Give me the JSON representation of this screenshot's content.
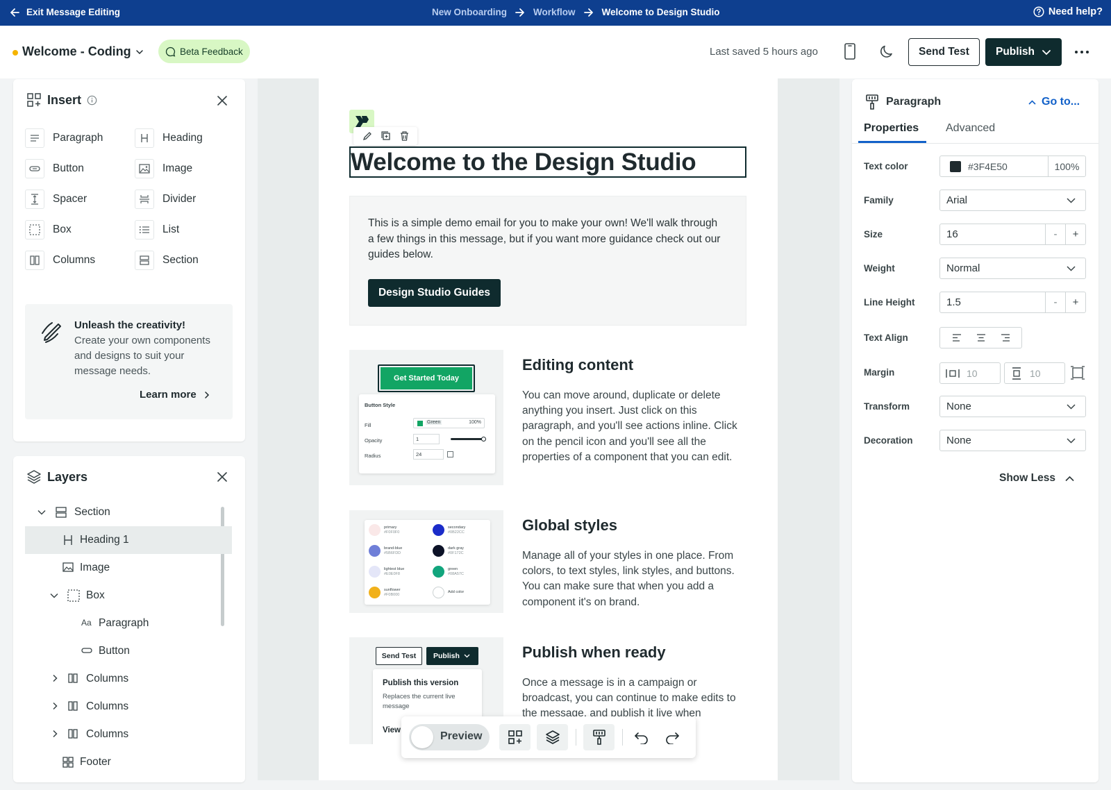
{
  "topbar": {
    "exit_label": "Exit Message Editing",
    "crumbs": [
      "New Onboarding",
      "Workflow",
      "Welcome to Design Studio"
    ],
    "help_label": "Need help?"
  },
  "header": {
    "message_name": "Welcome - Coding",
    "beta_label": "Beta Feedback",
    "saved_text": "Last saved 5 hours ago",
    "send_test_label": "Send Test",
    "publish_label": "Publish"
  },
  "insert_panel": {
    "title": "Insert",
    "items": [
      {
        "label": "Paragraph",
        "icon": "paragraph-icon"
      },
      {
        "label": "Heading",
        "icon": "heading-icon"
      },
      {
        "label": "Button",
        "icon": "button-icon"
      },
      {
        "label": "Image",
        "icon": "image-icon"
      },
      {
        "label": "Spacer",
        "icon": "spacer-icon"
      },
      {
        "label": "Divider",
        "icon": "divider-icon"
      },
      {
        "label": "Box",
        "icon": "box-icon"
      },
      {
        "label": "List",
        "icon": "list-icon"
      },
      {
        "label": "Columns",
        "icon": "columns-icon"
      },
      {
        "label": "Section",
        "icon": "section-icon"
      }
    ],
    "promo": {
      "title": "Unleash the creativity!",
      "body": "Create your own components and designs to suit your message needs.",
      "link": "Learn more"
    }
  },
  "layers_panel": {
    "title": "Layers",
    "items": [
      {
        "label": "Section",
        "icon": "section-icon"
      },
      {
        "label": "Heading 1",
        "icon": "heading-icon"
      },
      {
        "label": "Image",
        "icon": "image-icon"
      },
      {
        "label": "Box",
        "icon": "box-icon"
      },
      {
        "label": "Paragraph",
        "icon": "paragraph-text-icon"
      },
      {
        "label": "Button",
        "icon": "button-icon"
      },
      {
        "label": "Columns",
        "icon": "columns-icon"
      },
      {
        "label": "Columns",
        "icon": "columns-icon"
      },
      {
        "label": "Columns",
        "icon": "columns-icon"
      },
      {
        "label": "Footer",
        "icon": "footer-icon"
      }
    ]
  },
  "email": {
    "heading": "Welcome to the Design Studio",
    "intro": "This is a simple demo email for you to make your own! We'll walk through a few things in this message, but if you want more guidance check out our guides below.",
    "guides_button": "Design Studio Guides",
    "sections": [
      {
        "title": "Editing content",
        "body": "You can move around, duplicate or delete anything you insert. Just click on this paragraph, and you'll see actions inline. Click on the pencil icon and you'll see all the properties of a component that you can edit."
      },
      {
        "title": "Global styles",
        "body": "Manage all of your styles in one place. From colors, to text styles, link styles, and buttons. You can make sure that when you add a component it's on brand."
      },
      {
        "title": "Publish when ready",
        "body": "Once a message is in a campaign or broadcast, you can continue to make edits to the message, and publish it live when"
      }
    ],
    "thumb1": {
      "button": "Get Started Today",
      "card_title": "Button Style",
      "fill_label": "Fill",
      "fill_value": "Green",
      "fill_pct": "100%",
      "opacity_label": "Opacity",
      "opacity_value": "1",
      "radius_label": "Radius",
      "radius_value": "24"
    },
    "thumb2": {
      "swatches": [
        {
          "name": "primary",
          "hex": "#F0F0F0",
          "color": "#fae8e8"
        },
        {
          "name": "secondary",
          "hex": "#0B22CC",
          "color": "#1b2cc9"
        },
        {
          "name": "brand-blue",
          "hex": "#5B6FDD",
          "color": "#6f7fd8"
        },
        {
          "name": "dark gray",
          "hex": "#0F172C",
          "color": "#0c1227"
        },
        {
          "name": "lightest blue",
          "hex": "#E0E0F8",
          "color": "#e4e6f8"
        },
        {
          "name": "green",
          "hex": "#08A57C",
          "color": "#12a57d"
        },
        {
          "name": "sunflower",
          "hex": "#F0B000",
          "color": "#f1b11b"
        },
        {
          "name": "Add color",
          "hex": "",
          "color": "#ffffff"
        }
      ]
    },
    "thumb3": {
      "send_test": "Send Test",
      "publish": "Publish",
      "menu_title": "Publish this version",
      "menu_sub": "Replaces the current live message",
      "menu_view": "View"
    }
  },
  "properties_panel": {
    "component": "Paragraph",
    "goto": "Go to...",
    "tabs": [
      "Properties",
      "Advanced"
    ],
    "text_color_label": "Text color",
    "text_color_value": "#3F4E50",
    "text_color_swatch": "#1f2a2e",
    "text_color_opacity": "100%",
    "family_label": "Family",
    "family_value": "Arial",
    "size_label": "Size",
    "size_value": "16",
    "weight_label": "Weight",
    "weight_value": "Normal",
    "line_height_label": "Line Height",
    "line_height_value": "1.5",
    "text_align_label": "Text Align",
    "margin_label": "Margin",
    "margin_h": "10",
    "margin_v": "10",
    "transform_label": "Transform",
    "transform_value": "None",
    "decoration_label": "Decoration",
    "decoration_value": "None",
    "show_less": "Show Less",
    "stepper_minus": "-",
    "stepper_plus": "+"
  },
  "bottom_toolbar": {
    "preview_label": "Preview"
  },
  "colors": {
    "topbar": "#0e3f8f",
    "primary_dark": "#0f2b2e",
    "link_blue": "#1261c9",
    "beta_bg": "#d8f7c4",
    "green_button": "#12a564"
  }
}
